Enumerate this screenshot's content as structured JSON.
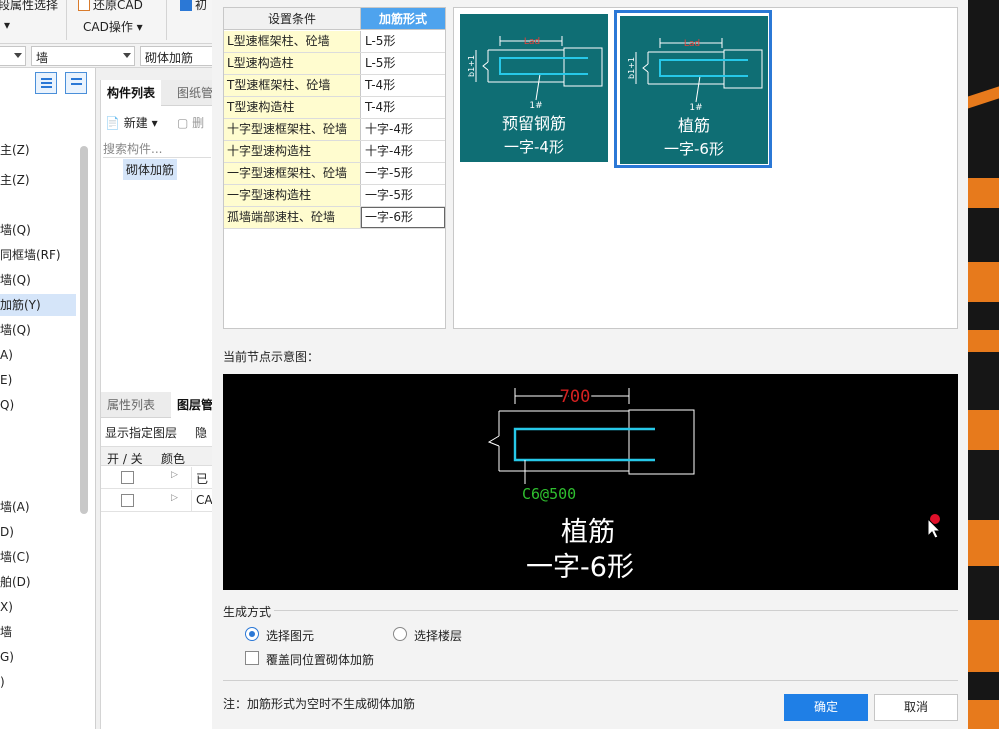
{
  "toolbar": {
    "attr_select_partial": "段属性选择",
    "restore_cad": "还原CAD",
    "cad_ops": "CAD操作",
    "btn_partial": "初"
  },
  "selectors": {
    "floor_partial": "",
    "type": "墙",
    "component": "砌体加筋"
  },
  "left_panel": {
    "items": [
      "主(Z)",
      "主(Z)",
      "墙(Q)",
      "同框墙(RF)",
      "墙(Q)",
      "加筋(Y)",
      "墙(Q)",
      "A)",
      "E)",
      "Q)",
      "墙(A)",
      "D)",
      "墙(C)",
      "舶(D)",
      "X)",
      "墙",
      "G)",
      ")"
    ],
    "selected_index": 5
  },
  "component_panel": {
    "tabs": [
      "构件列表",
      "图纸管"
    ],
    "new_label": "新建",
    "delete_label": "删",
    "search_placeholder": "搜索构件...",
    "items": [
      "砌体加筋"
    ]
  },
  "layer_panel": {
    "tabs": [
      "属性列表",
      "图层管"
    ],
    "show_label": "显示指定图层",
    "hide_label": "隐",
    "col_onoff": "开 / 关",
    "col_color": "颜色",
    "rows": [
      "已",
      "CA"
    ]
  },
  "dialog": {
    "table_headers": [
      "设置条件",
      "加筋形式"
    ],
    "rows": [
      {
        "condition": "L型速框架柱、砼墙",
        "form": "L-5形"
      },
      {
        "condition": "L型速构造柱",
        "form": "L-5形"
      },
      {
        "condition": "T型速框架柱、砼墙",
        "form": "T-4形"
      },
      {
        "condition": "T型速构造柱",
        "form": "T-4形"
      },
      {
        "condition": "十字型速框架柱、砼墙",
        "form": "十字-4形"
      },
      {
        "condition": "十字型速构造柱",
        "form": "十字-4形"
      },
      {
        "condition": "一字型速框架柱、砼墙",
        "form": "一字-5形"
      },
      {
        "condition": "一字型速构造柱",
        "form": "一字-5形"
      },
      {
        "condition": "孤墙端部速柱、砼墙",
        "form": "一字-6形"
      }
    ],
    "thumbnails": [
      {
        "line1": "预留钢筋",
        "line2": "一字-4形",
        "mark": "1#",
        "dim": "Lad",
        "side": "b1+1",
        "selected": false
      },
      {
        "line1": "植筋",
        "line2": "一字-6形",
        "mark": "1#",
        "dim": "Lad",
        "side": "b1+1",
        "selected": true
      }
    ],
    "preview_label": "当前节点示意图：",
    "preview": {
      "dimension": "700",
      "rebar": "C6@500",
      "line1": "植筋",
      "line2": "一字-6形"
    },
    "generation": {
      "title": "生成方式",
      "option_element": "选择图元",
      "option_floor": "选择楼层",
      "selected": "element",
      "overwrite_label": "覆盖同位置砌体加筋",
      "overwrite_checked": false
    },
    "note": "注：加筋形式为空时不生成砌体加筋",
    "ok": "确定",
    "cancel": "取消"
  },
  "colors": {
    "accent": "#1f7fe6",
    "header_blue": "#4ea3ee",
    "condition_bg": "#fffccf",
    "thumb_bg": "#0f6e74",
    "preview_red": "#d42020",
    "preview_green": "#2fbf2f",
    "preview_cyan": "#27c8e8"
  }
}
